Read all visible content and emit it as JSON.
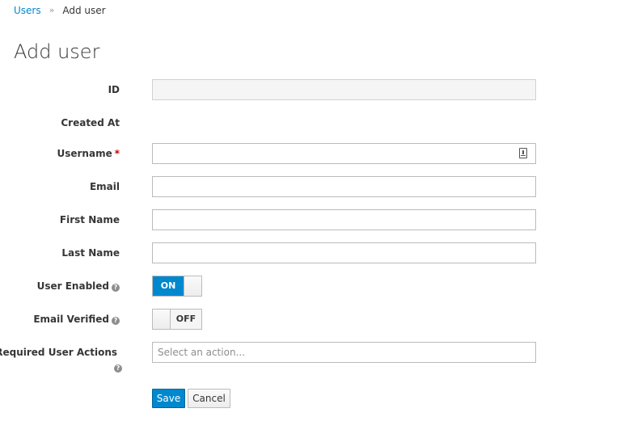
{
  "breadcrumb": {
    "parent": "Users",
    "separator": "»",
    "current": "Add user"
  },
  "page_title": "Add user",
  "form": {
    "id_label": "ID",
    "id_value": "",
    "created_at_label": "Created At",
    "username_label": "Username",
    "username_required_marker": "*",
    "username_value": "",
    "email_label": "Email",
    "email_value": "",
    "first_name_label": "First Name",
    "first_name_value": "",
    "last_name_label": "Last Name",
    "last_name_value": "",
    "user_enabled_label": "User Enabled",
    "user_enabled_state": "ON",
    "email_verified_label": "Email Verified",
    "email_verified_state": "OFF",
    "required_actions_label": "Required User Actions",
    "required_actions_placeholder": "Select an action..."
  },
  "help_icon_glyph": "?",
  "buttons": {
    "save": "Save",
    "cancel": "Cancel"
  },
  "colors": {
    "accent": "#0088ce",
    "required": "#cc0000",
    "text": "#363636"
  },
  "icons": {
    "username_field_icon": "keyboard-lock-icon",
    "help": "question-circle-icon"
  }
}
